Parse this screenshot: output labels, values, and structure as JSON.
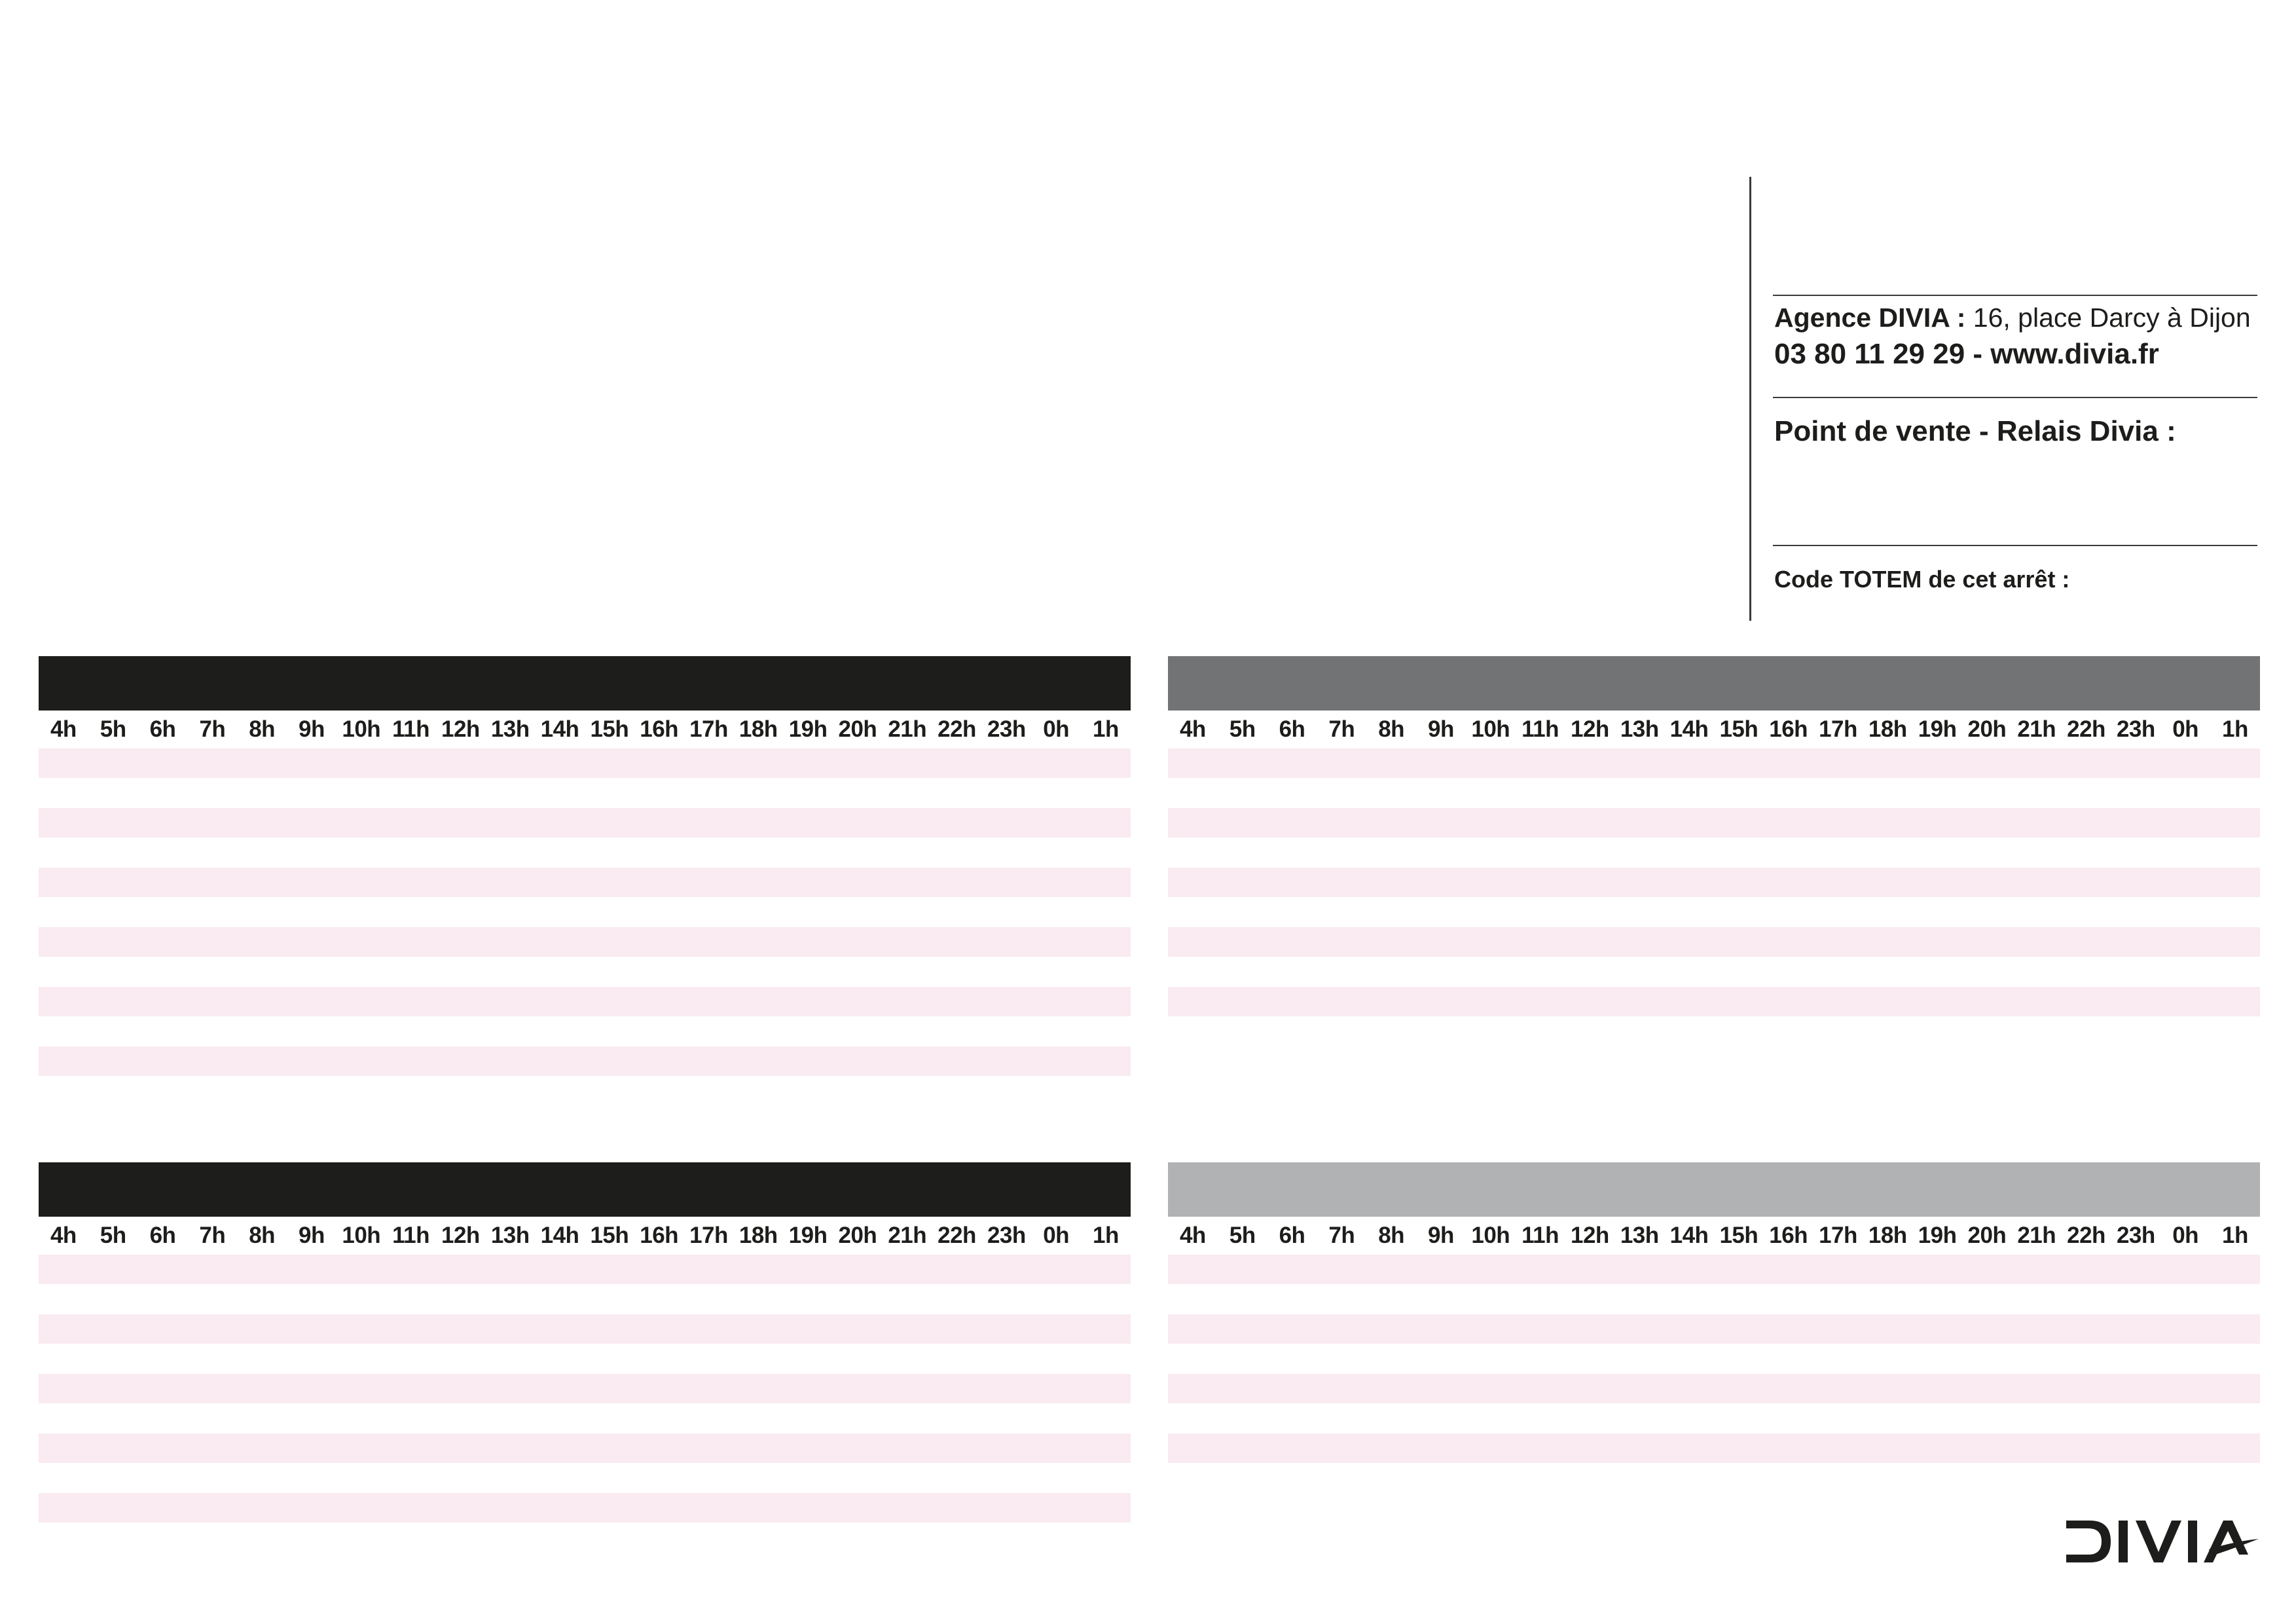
{
  "info": {
    "agency_label": "Agence DIVIA :",
    "agency_address": "16, place Darcy à Dijon",
    "contact": "03 80 11 29 29 - www.divia.fr",
    "sales_point": "Point de vente - Relais Divia :",
    "totem_code": "Code TOTEM de cet arrêt :"
  },
  "hours": [
    "4h",
    "5h",
    "6h",
    "7h",
    "8h",
    "9h",
    "10h",
    "11h",
    "12h",
    "13h",
    "14h",
    "15h",
    "16h",
    "17h",
    "18h",
    "19h",
    "20h",
    "21h",
    "22h",
    "23h",
    "0h",
    "1h"
  ],
  "panels": [
    {
      "id": "top-left",
      "header_color": "#1d1d1b",
      "stripe_count": 6
    },
    {
      "id": "top-right",
      "header_color": "#727375",
      "stripe_count": 5
    },
    {
      "id": "bottom-left",
      "header_color": "#1d1d1b",
      "stripe_count": 5
    },
    {
      "id": "bottom-right",
      "header_color": "#b1b2b4",
      "stripe_count": 4
    }
  ],
  "colors": {
    "stripe": "#f9ebf1",
    "text": "#1d1d1b"
  },
  "logo": {
    "text": "DIVIA",
    "icon": "divia-logo-icon"
  }
}
